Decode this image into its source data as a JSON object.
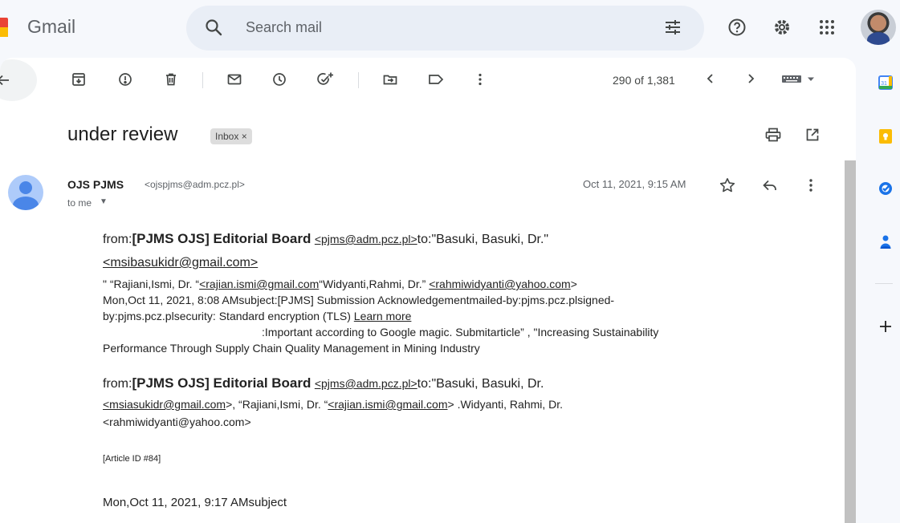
{
  "app": {
    "name": "Gmail"
  },
  "search": {
    "placeholder": "Search mail"
  },
  "toolbar": {
    "pager": "290 of 1,381",
    "icons": [
      "archive-icon",
      "report-spam-icon",
      "delete-icon",
      "mark-unread-icon",
      "snooze-icon",
      "add-task-icon",
      "move-to-icon",
      "label-icon",
      "more-vert-icon"
    ]
  },
  "thread": {
    "subject": "under review",
    "label_chip": "Inbox ×"
  },
  "message": {
    "sender_name": "OJS PJMS",
    "sender_email": "<ojspjms@adm.pcz.pl>",
    "to": "to me",
    "date": "Oct 11, 2021, 9:15 AM"
  },
  "body": {
    "p1": {
      "from_label": "from:",
      "from_name": "[PJMS OJS] Editorial Board",
      "from_email": "<pjms@adm.pcz.pl>",
      "to_text": "to:\"Basuki, Basuki, Dr.\"",
      "to_email": "<msibasukidr@gmail.com>",
      "line3_a": "\" “Rajiani,Ismi, Dr. “",
      "line3_link1": "<rajian.ismi@gmail.com",
      "line3_b": "“Widyanti,Rahmi, Dr.” ",
      "line3_link2": "<rahmiwidyanti@yahoo.com",
      "line3_c": ">",
      "line4": "Mon,Oct 11, 2021, 8:08 AMsubject:[PJMS] Submission Acknowledgementmailed-by:pjms.pcz.plsigned-",
      "line5_a": "by:pjms.pcz.plsecurity: Standard encryption (TLS) ",
      "learn_more": "Learn more",
      "line6": ":Important according to Google magic. Submitarticle” , \"Increasing Sustainability",
      "line7": "Performance Through Supply Chain Quality Management in Mining Industry"
    },
    "p2": {
      "from_label": "from:",
      "from_name": "[PJMS OJS] Editorial Board",
      "from_email": "<pjms@adm.pcz.pl>",
      "to_text": "to:\"Basuki, Basuki, Dr.",
      "to_email": "<msiasukidr@gmail.com",
      "line2_b": ">, “Rajiani,Ismi, Dr. “",
      "line2_link": "<rajian.ismi@gmail.com",
      "line2_c": "> .Widyanti, Rahmi, Dr.",
      "line3": "<rahmiwidyanti@yahoo.com>"
    },
    "article_id": "[Article ID #84]",
    "final_line": "Mon,Oct 11, 2021, 9:17 AMsubject"
  },
  "side_rail": {
    "icons": [
      "calendar-icon",
      "keep-icon",
      "tasks-icon",
      "contacts-icon",
      "add-icon"
    ],
    "calendar_day": "31"
  }
}
